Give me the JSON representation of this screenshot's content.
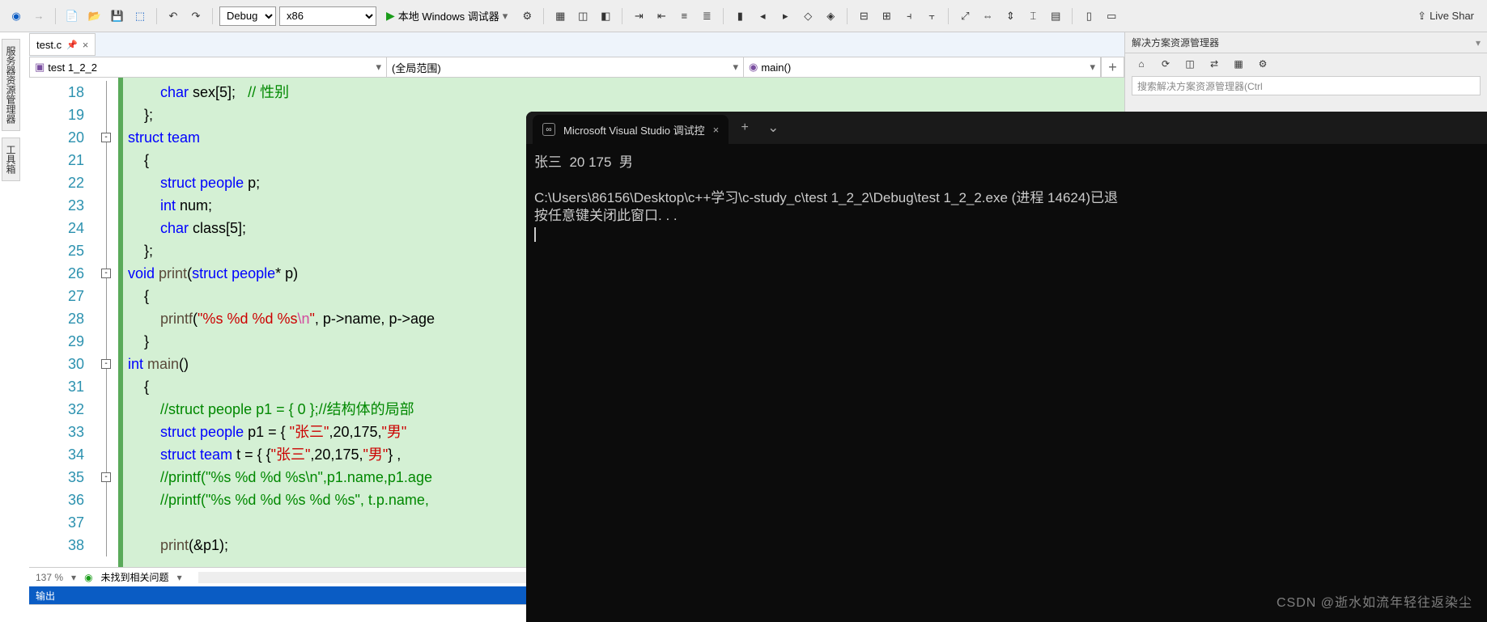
{
  "toolbar": {
    "config": "Debug",
    "platform": "x86",
    "debugger_label": "本地 Windows 调试器",
    "live_share": "Live Shar"
  },
  "sidebars": {
    "server_explorer": "服务器资源管理器",
    "toolbox": "工具箱"
  },
  "file_tab": {
    "name": "test.c"
  },
  "scope": {
    "project": "test 1_2_2",
    "scope": "(全局范围)",
    "function": "main()"
  },
  "code": {
    "lines": [
      {
        "n": 18,
        "html": "        <span class='kw'>char</span> sex[5];   <span class='cmt'>// 性别</span>"
      },
      {
        "n": 19,
        "html": "    };"
      },
      {
        "n": 20,
        "html": "<span class='kw'>struct</span> <span class='typ'>team</span>",
        "fold": "-"
      },
      {
        "n": 21,
        "html": "    {"
      },
      {
        "n": 22,
        "html": "        <span class='kw'>struct</span> <span class='typ'>people</span> p;"
      },
      {
        "n": 23,
        "html": "        <span class='kw'>int</span> num;"
      },
      {
        "n": 24,
        "html": "        <span class='kw'>char</span> class[5];"
      },
      {
        "n": 25,
        "html": "    };"
      },
      {
        "n": 26,
        "html": "<span class='kw'>void</span> <span class='fn'>print</span>(<span class='kw'>struct</span> <span class='typ'>people</span>* p)",
        "fold": "-"
      },
      {
        "n": 27,
        "html": "    {"
      },
      {
        "n": 28,
        "html": "        <span class='fn'>printf</span>(<span class='str'>\"%s %d %d %s</span><span class='esc'>\\n</span><span class='str'>\"</span>, p-&gt;name, p-&gt;age"
      },
      {
        "n": 29,
        "html": "    }"
      },
      {
        "n": 30,
        "html": "<span class='kw'>int</span> <span class='fn'>main</span>()",
        "fold": "-"
      },
      {
        "n": 31,
        "html": "    {"
      },
      {
        "n": 32,
        "html": "        <span class='cmt'>//struct people p1 = { 0 };//结构体的局部</span>"
      },
      {
        "n": 33,
        "html": "        <span class='kw'>struct</span> <span class='typ'>people</span> p1 = { <span class='str'>\"张三\"</span>,20,175,<span class='str'>\"男\"</span>"
      },
      {
        "n": 34,
        "html": "        <span class='kw'>struct</span> <span class='typ'>team</span> t = { {<span class='str'>\"张三\"</span>,20,175,<span class='str'>\"男\"</span>} ,"
      },
      {
        "n": 35,
        "html": "        <span class='cmt'>//printf(\"%s %d %d %s\\n\",p1.name,p1.age</span>",
        "fold": "-"
      },
      {
        "n": 36,
        "html": "        <span class='cmt'>//printf(\"%s %d %d %s %d %s\", t.p.name,</span>"
      },
      {
        "n": 37,
        "html": ""
      },
      {
        "n": 38,
        "html": "        <span class='fn'>print</span>(&amp;p1);"
      }
    ]
  },
  "status": {
    "zoom": "137 %",
    "issues": "未找到相关问题"
  },
  "output_title": "输出",
  "right_panel": {
    "title": "解决方案资源管理器",
    "search_placeholder": "搜索解决方案资源管理器(Ctrl"
  },
  "terminal": {
    "tab_title": "Microsoft Visual Studio 调试控",
    "line1": "张三  20 175  男",
    "line2": "C:\\Users\\86156\\Desktop\\c++学习\\c-study_c\\test 1_2_2\\Debug\\test 1_2_2.exe (进程 14624)已退",
    "line3": "按任意键关闭此窗口. . ."
  },
  "watermark": "CSDN @逝水如流年轻往返染尘"
}
